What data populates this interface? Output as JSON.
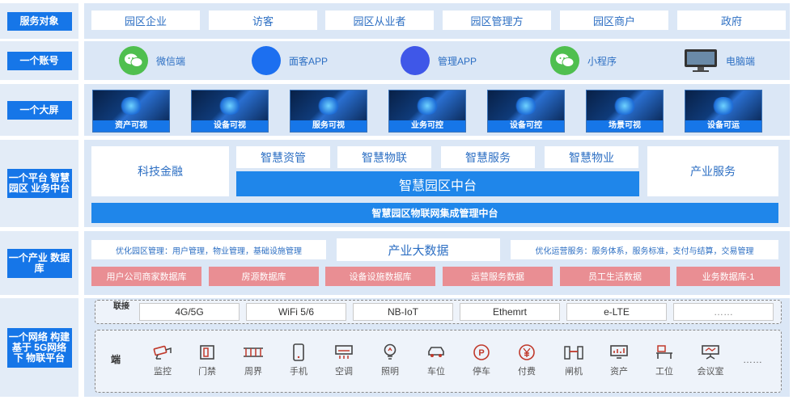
{
  "rows": {
    "service": "服务对象",
    "account": "一个账号",
    "screen": "一个大屏",
    "platform": "一个平台 智慧园区 业务中台",
    "database": "一个产业 数据库",
    "network": "一个网络 构建基于 5G网络下 物联平台"
  },
  "service_objects": [
    "园区企业",
    "访客",
    "园区从业者",
    "园区管理方",
    "园区商户",
    "政府"
  ],
  "accounts": [
    {
      "label": "微信端",
      "icon": "wechat-icon"
    },
    {
      "label": "面客APP",
      "icon": "app-circle-icon"
    },
    {
      "label": "管理APP",
      "icon": "app-circle-icon"
    },
    {
      "label": "小程序",
      "icon": "miniprogram-icon"
    },
    {
      "label": "电脑端",
      "icon": "monitor-icon"
    }
  ],
  "screens": [
    "资产可视",
    "设备可视",
    "服务可视",
    "业务可控",
    "设备可控",
    "场景可视",
    "设备可运"
  ],
  "platform": {
    "left": "科技金融",
    "right": "产业服务",
    "modules": [
      "智慧资管",
      "智慧物联",
      "智慧服务",
      "智慧物业"
    ],
    "center": "智慧园区中台",
    "bottom": "智慧园区物联网集成管理中台"
  },
  "database": {
    "left_note": "优化园区管理：用户管理，物业管理，基础设施管理",
    "center": "产业大数据",
    "right_note": "优化运营服务：服务体系，服务标准，支付与结算，交易管理",
    "items": [
      "用户公司商家数据库",
      "房源数据库",
      "设备设施数据库",
      "运营服务数据",
      "员工生活数据",
      "业务数据库-1"
    ]
  },
  "network": {
    "connect_label": "联接",
    "items": [
      "4G/5G",
      "WiFi 5/6",
      "NB-IoT",
      "Ethemrt",
      "e-LTE",
      "……"
    ],
    "endpoint_label": "端",
    "devices": [
      {
        "label": "监控",
        "icon": "camera-icon"
      },
      {
        "label": "门禁",
        "icon": "door-icon"
      },
      {
        "label": "周界",
        "icon": "fence-icon"
      },
      {
        "label": "手机",
        "icon": "phone-icon"
      },
      {
        "label": "空调",
        "icon": "aircon-icon"
      },
      {
        "label": "照明",
        "icon": "bulb-icon"
      },
      {
        "label": "车位",
        "icon": "car-icon"
      },
      {
        "label": "停车",
        "icon": "parking-icon"
      },
      {
        "label": "付费",
        "icon": "payment-icon"
      },
      {
        "label": "闸机",
        "icon": "gate-icon"
      },
      {
        "label": "资产",
        "icon": "asset-icon"
      },
      {
        "label": "工位",
        "icon": "workstation-icon"
      },
      {
        "label": "会议室",
        "icon": "meeting-room-icon"
      }
    ],
    "more": "……"
  },
  "colors": {
    "primary": "#1676e8",
    "panel": "#dbe7f6",
    "pink": "#e98e93",
    "text": "#2d6fc3"
  }
}
